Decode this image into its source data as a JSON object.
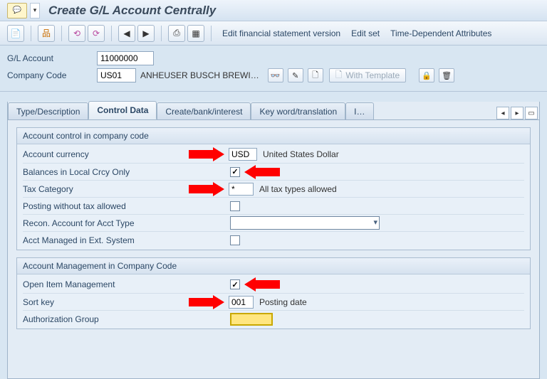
{
  "title": "Create G/L Account Centrally",
  "toolbar": {
    "links": {
      "fin_stmt": "Edit financial statement version",
      "edit_set": "Edit set",
      "time_dep": "Time-Dependent Attributes"
    }
  },
  "header": {
    "gl_label": "G/L Account",
    "gl_value": "11000000",
    "cc_label": "Company Code",
    "cc_value": "US01",
    "cc_desc": "ANHEUSER BUSCH BREWI…",
    "with_template": "With Template"
  },
  "tabs": {
    "t1": "Type/Description",
    "t2": "Control Data",
    "t3": "Create/bank/interest",
    "t4": "Key word/translation",
    "t5": "I…"
  },
  "group1": {
    "title": "Account control in company code",
    "currency_label": "Account currency",
    "currency_value": "USD",
    "currency_desc": "United States Dollar",
    "balances_label": "Balances in Local Crcy Only",
    "balances_checked": "✓",
    "taxcat_label": "Tax Category",
    "taxcat_value": "*",
    "taxcat_desc": "All tax types allowed",
    "postnotax_label": "Posting without tax allowed",
    "recon_label": "Recon. Account for Acct Type",
    "extsys_label": "Acct Managed in Ext. System"
  },
  "group2": {
    "title": "Account Management in Company Code",
    "openitem_label": "Open Item Management",
    "openitem_checked": "✓",
    "sortkey_label": "Sort key",
    "sortkey_value": "001",
    "sortkey_desc": "Posting date",
    "authgrp_label": "Authorization Group"
  }
}
